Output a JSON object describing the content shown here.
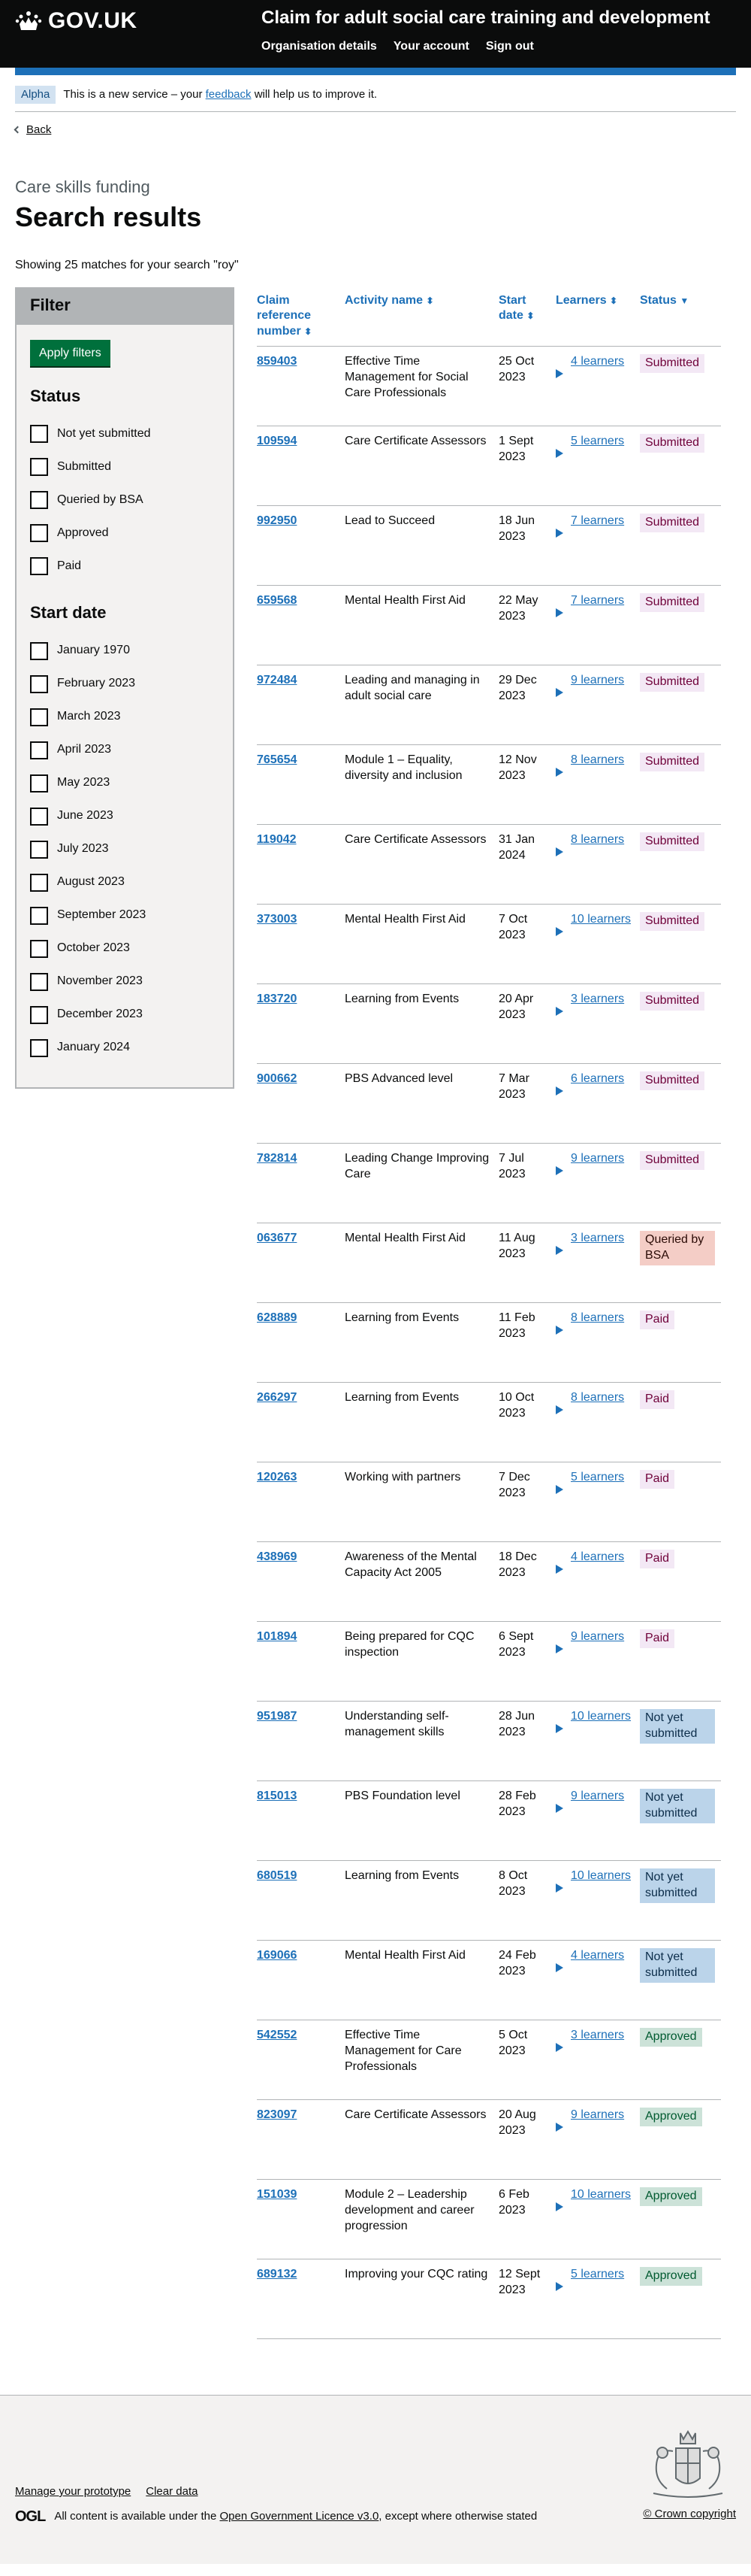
{
  "header": {
    "logo_text": "GOV.UK",
    "service_name": "Claim for adult social care training and development",
    "nav": [
      "Organisation details",
      "Your account",
      "Sign out"
    ]
  },
  "phase": {
    "tag": "Alpha",
    "text_before": "This is a new service – your",
    "link": "feedback",
    "text_after": "will help us to improve it."
  },
  "back_link": "Back",
  "caption": "Care skills funding",
  "title": "Search results",
  "result_count": "Showing 25 matches for your search \"roy\"",
  "filter": {
    "heading": "Filter",
    "apply_button": "Apply filters",
    "status_heading": "Status",
    "status_options": [
      "Not yet submitted",
      "Submitted",
      "Queried by BSA",
      "Approved",
      "Paid"
    ],
    "date_heading": "Start date",
    "date_options": [
      "January 1970",
      "February 2023",
      "March 2023",
      "April 2023",
      "May 2023",
      "June 2023",
      "July 2023",
      "August 2023",
      "September 2023",
      "October 2023",
      "November 2023",
      "December 2023",
      "January 2024"
    ]
  },
  "table": {
    "headers": [
      "Claim reference number",
      "Activity name",
      "Start date",
      "Learners",
      "Status"
    ],
    "sort_markers": [
      "⬍",
      "⬍",
      "⬍",
      "⬍",
      "▼"
    ],
    "rows": [
      {
        "ref": "859403",
        "activity": "Effective Time Management for Social Care Professionals",
        "date": "25 Oct 2023",
        "learners": "4 learners",
        "status": "Submitted",
        "status_type": "sub"
      },
      {
        "ref": "109594",
        "activity": "Care Certificate Assessors",
        "date": "1 Sept 2023",
        "learners": "5 learners",
        "status": "Submitted",
        "status_type": "sub"
      },
      {
        "ref": "992950",
        "activity": "Lead to Succeed",
        "date": "18 Jun 2023",
        "learners": "7 learners",
        "status": "Submitted",
        "status_type": "sub"
      },
      {
        "ref": "659568",
        "activity": "Mental Health First Aid",
        "date": "22 May 2023",
        "learners": "7 learners",
        "status": "Submitted",
        "status_type": "sub"
      },
      {
        "ref": "972484",
        "activity": "Leading and managing in adult social care",
        "date": "29 Dec 2023",
        "learners": "9 learners",
        "status": "Submitted",
        "status_type": "sub"
      },
      {
        "ref": "765654",
        "activity": "Module 1 – Equality, diversity and inclusion",
        "date": "12 Nov 2023",
        "learners": "8 learners",
        "status": "Submitted",
        "status_type": "sub"
      },
      {
        "ref": "119042",
        "activity": "Care Certificate Assessors",
        "date": "31 Jan 2024",
        "learners": "8 learners",
        "status": "Submitted",
        "status_type": "sub"
      },
      {
        "ref": "373003",
        "activity": "Mental Health First Aid",
        "date": "7 Oct 2023",
        "learners": "10 learners",
        "status": "Submitted",
        "status_type": "sub"
      },
      {
        "ref": "183720",
        "activity": "Learning from Events",
        "date": "20 Apr 2023",
        "learners": "3 learners",
        "status": "Submitted",
        "status_type": "sub"
      },
      {
        "ref": "900662",
        "activity": "PBS Advanced level",
        "date": "7 Mar 2023",
        "learners": "6 learners",
        "status": "Submitted",
        "status_type": "sub"
      },
      {
        "ref": "782814",
        "activity": "Leading Change Improving Care",
        "date": "7 Jul 2023",
        "learners": "9 learners",
        "status": "Submitted",
        "status_type": "sub"
      },
      {
        "ref": "063677",
        "activity": "Mental Health First Aid",
        "date": "11 Aug 2023",
        "learners": "3 learners",
        "status": "Queried by BSA",
        "status_type": "q"
      },
      {
        "ref": "628889",
        "activity": "Learning from Events",
        "date": "11 Feb 2023",
        "learners": "8 learners",
        "status": "Paid",
        "status_type": "paid"
      },
      {
        "ref": "266297",
        "activity": "Learning from Events",
        "date": "10 Oct 2023",
        "learners": "8 learners",
        "status": "Paid",
        "status_type": "paid"
      },
      {
        "ref": "120263",
        "activity": "Working with partners",
        "date": "7 Dec 2023",
        "learners": "5 learners",
        "status": "Paid",
        "status_type": "paid"
      },
      {
        "ref": "438969",
        "activity": "Awareness of the Mental Capacity Act 2005",
        "date": "18 Dec 2023",
        "learners": "4 learners",
        "status": "Paid",
        "status_type": "paid"
      },
      {
        "ref": "101894",
        "activity": "Being prepared for CQC inspection",
        "date": "6 Sept 2023",
        "learners": "9 learners",
        "status": "Paid",
        "status_type": "paid"
      },
      {
        "ref": "951987",
        "activity": "Understanding self-management skills",
        "date": "28 Jun 2023",
        "learners": "10 learners",
        "status": "Not yet submitted",
        "status_type": "nys"
      },
      {
        "ref": "815013",
        "activity": "PBS Foundation level",
        "date": "28 Feb 2023",
        "learners": "9 learners",
        "status": "Not yet submitted",
        "status_type": "nys"
      },
      {
        "ref": "680519",
        "activity": "Learning from Events",
        "date": "8 Oct 2023",
        "learners": "10 learners",
        "status": "Not yet submitted",
        "status_type": "nys"
      },
      {
        "ref": "169066",
        "activity": "Mental Health First Aid",
        "date": "24 Feb 2023",
        "learners": "4 learners",
        "status": "Not yet submitted",
        "status_type": "nys"
      },
      {
        "ref": "542552",
        "activity": "Effective Time Management for Care Professionals",
        "date": "5 Oct 2023",
        "learners": "3 learners",
        "status": "Approved",
        "status_type": "app"
      },
      {
        "ref": "823097",
        "activity": "Care Certificate Assessors",
        "date": "20 Aug 2023",
        "learners": "9 learners",
        "status": "Approved",
        "status_type": "app"
      },
      {
        "ref": "151039",
        "activity": "Module 2 – Leadership development and career progression",
        "date": "6 Feb 2023",
        "learners": "10 learners",
        "status": "Approved",
        "status_type": "app"
      },
      {
        "ref": "689132",
        "activity": "Improving your CQC rating",
        "date": "12 Sept 2023",
        "learners": "5 learners",
        "status": "Approved",
        "status_type": "app"
      }
    ]
  },
  "footer": {
    "links": [
      "Manage your prototype",
      "Clear data"
    ],
    "ogl": "OGL",
    "licence_before": "All content is available under the",
    "licence_link": "Open Government Licence v3.0",
    "licence_after": ", except where otherwise stated",
    "copyright": "© Crown copyright"
  },
  "colors": {
    "header_bg": "#0b0c0c",
    "brand_blue": "#1d70b8",
    "button_green": "#00703c"
  }
}
